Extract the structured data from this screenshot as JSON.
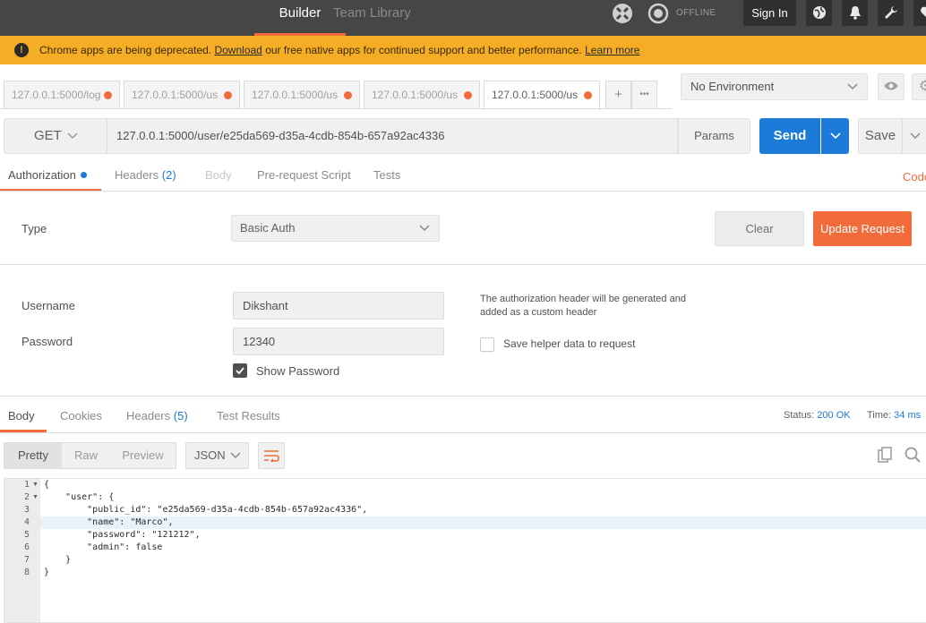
{
  "topbar": {
    "builder": "Builder",
    "team_library": "Team Library",
    "offline": "OFFLINE",
    "sign_in": "Sign In"
  },
  "banner": {
    "text_before": "Chrome apps are being deprecated.",
    "download_link": "Download",
    "text_middle": "our free native apps for continued support and better performance.",
    "learn_more": "Learn more"
  },
  "tabs": [
    {
      "label": "127.0.0.1:5000/log"
    },
    {
      "label": "127.0.0.1:5000/us"
    },
    {
      "label": "127.0.0.1:5000/us"
    },
    {
      "label": "127.0.0.1:5000/us"
    },
    {
      "label": "127.0.0.1:5000/us"
    }
  ],
  "tab_controls": {
    "add": "+",
    "more": "•••"
  },
  "environment": {
    "selected": "No Environment"
  },
  "request": {
    "method": "GET",
    "url": "127.0.0.1:5000/user/e25da569-d35a-4cdb-854b-657a92ac4336",
    "params": "Params",
    "send": "Send",
    "save": "Save"
  },
  "request_tabs": {
    "authorization": "Authorization",
    "headers": "Headers",
    "headers_count": "(2)",
    "body": "Body",
    "prerequest": "Pre-request Script",
    "tests": "Tests",
    "code": "Code"
  },
  "auth": {
    "type_label": "Type",
    "type_value": "Basic Auth",
    "clear": "Clear",
    "update": "Update Request",
    "username_label": "Username",
    "username_value": "Dikshant",
    "password_label": "Password",
    "password_value": "12340",
    "show_password": "Show Password",
    "note": "The authorization header will be generated and added as a custom header",
    "save_helper": "Save helper data to request"
  },
  "response_tabs": {
    "body": "Body",
    "cookies": "Cookies",
    "headers": "Headers",
    "headers_count": "(5)",
    "test_results": "Test Results"
  },
  "response_meta": {
    "status_label": "Status:",
    "status_value": "200 OK",
    "time_label": "Time:",
    "time_value": "34 ms"
  },
  "response_view": {
    "pretty": "Pretty",
    "raw": "Raw",
    "preview": "Preview",
    "format": "JSON"
  },
  "code_lines": [
    {
      "n": "1",
      "text": "{"
    },
    {
      "n": "2",
      "text": "    \"user\": {"
    },
    {
      "n": "3",
      "text": "        \"public_id\": \"e25da569-d35a-4cdb-854b-657a92ac4336\","
    },
    {
      "n": "4",
      "text": "        \"name\": \"Marco\","
    },
    {
      "n": "5",
      "text": "        \"password\": \"121212\","
    },
    {
      "n": "6",
      "text": "        \"admin\": false"
    },
    {
      "n": "7",
      "text": "    }"
    },
    {
      "n": "8",
      "text": "}"
    }
  ]
}
